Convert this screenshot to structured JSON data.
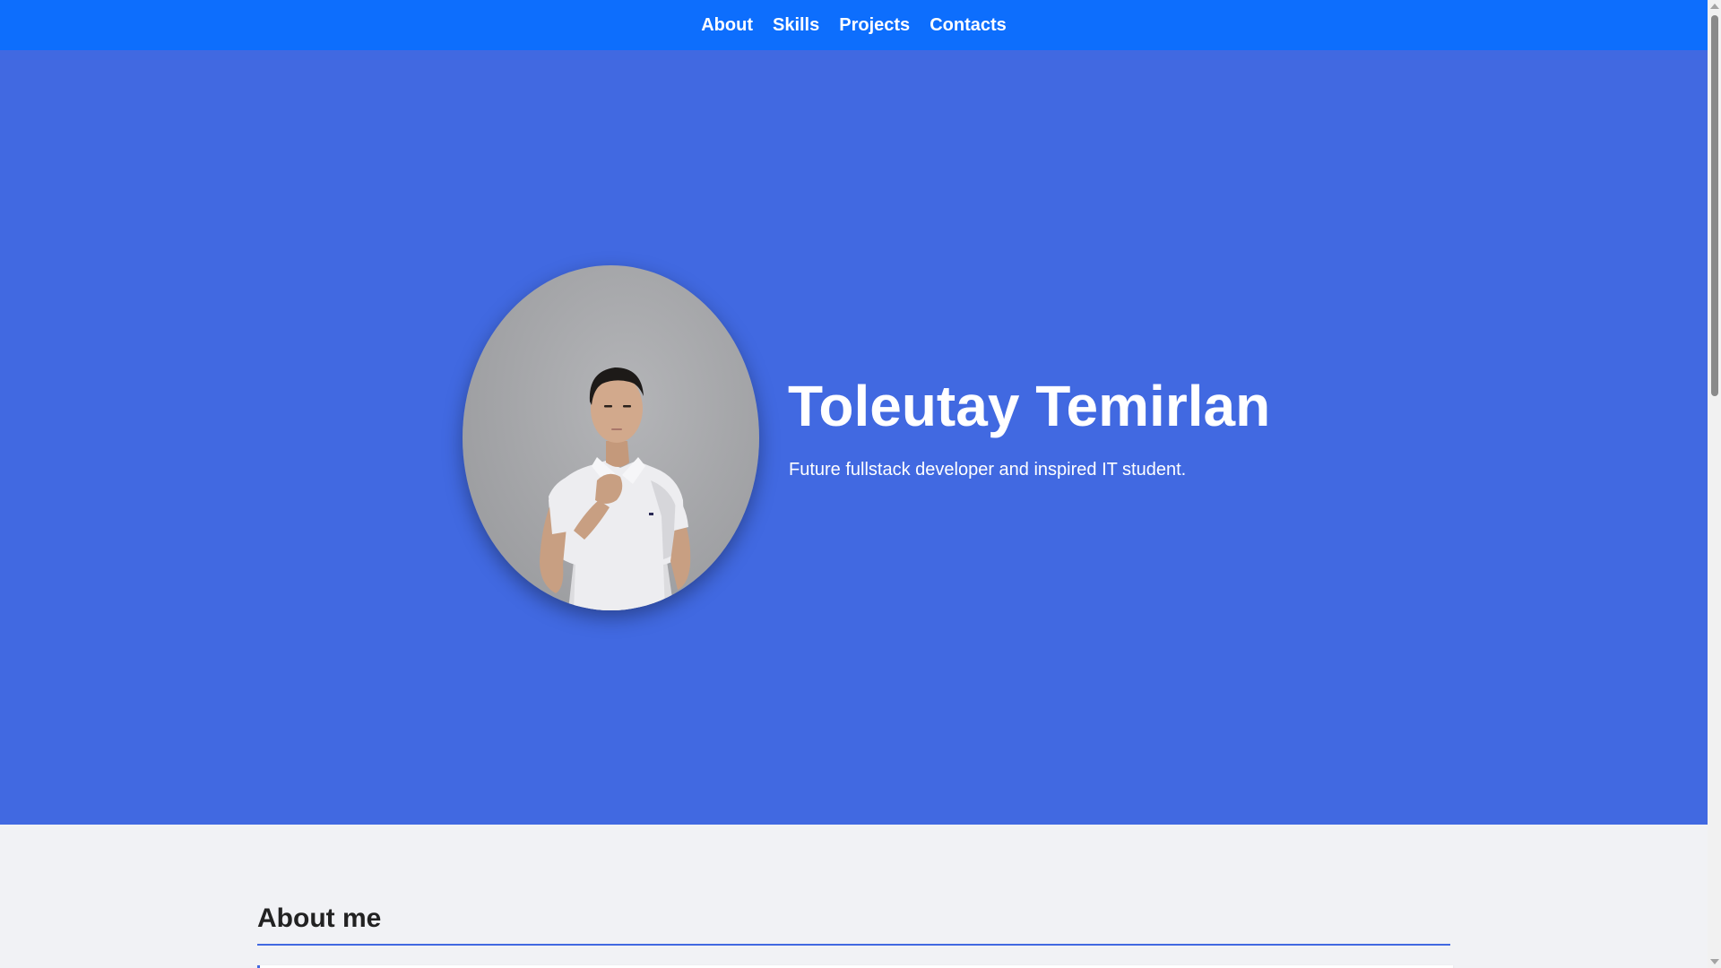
{
  "nav": {
    "items": [
      {
        "label": "About"
      },
      {
        "label": "Skills"
      },
      {
        "label": "Projects"
      },
      {
        "label": "Contacts"
      }
    ]
  },
  "hero": {
    "name": "Toleutay Temirlan",
    "tagline": "Future fullstack developer and inspired IT student.",
    "photo": "profile-photo"
  },
  "about": {
    "title": "About me"
  },
  "colors": {
    "nav_bg": "#0d6efd",
    "hero_bg": "#4169e1",
    "page_bg": "#f1f2f5",
    "text_dark": "#222222",
    "text_light": "#ffffff"
  }
}
